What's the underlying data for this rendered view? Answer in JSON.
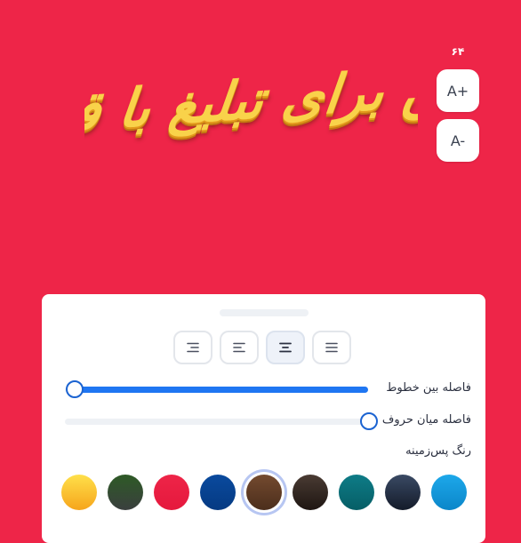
{
  "preview": {
    "text": "متن برای تبلیغ با قمر"
  },
  "font_size": {
    "value": "۶۴",
    "increase_label": "A+",
    "decrease_label": "A-"
  },
  "alignment": {
    "options": [
      "right",
      "center",
      "left",
      "justify"
    ],
    "selected": "center"
  },
  "line_spacing": {
    "label": "فاصله بین خطوط",
    "value_fraction": 0.97
  },
  "letter_spacing": {
    "label": "فاصله میان حروف",
    "value_fraction": 0.0
  },
  "background": {
    "label": "رنگ پس‌زمینه",
    "selected_index": 4,
    "colors": [
      {
        "name": "sky-blue",
        "top": "#1DA8EA",
        "bottom": "#0B86C9"
      },
      {
        "name": "navy-gray",
        "top": "#3A4A64",
        "bottom": "#141B2A"
      },
      {
        "name": "teal",
        "top": "#0E7C87",
        "bottom": "#065E66"
      },
      {
        "name": "dark-brown",
        "top": "#4A3B33",
        "bottom": "#1E1612"
      },
      {
        "name": "brown",
        "top": "#744A2F",
        "bottom": "#4C2E1C"
      },
      {
        "name": "royal-blue",
        "top": "#0A4A9E",
        "bottom": "#053A82"
      },
      {
        "name": "red",
        "top": "#EE2548",
        "bottom": "#E5183D"
      },
      {
        "name": "dark-green",
        "top": "#2E5A26",
        "bottom": "#3A3F3E"
      },
      {
        "name": "yellow-orange",
        "top": "#FFE04A",
        "bottom": "#F6A51C"
      }
    ]
  }
}
